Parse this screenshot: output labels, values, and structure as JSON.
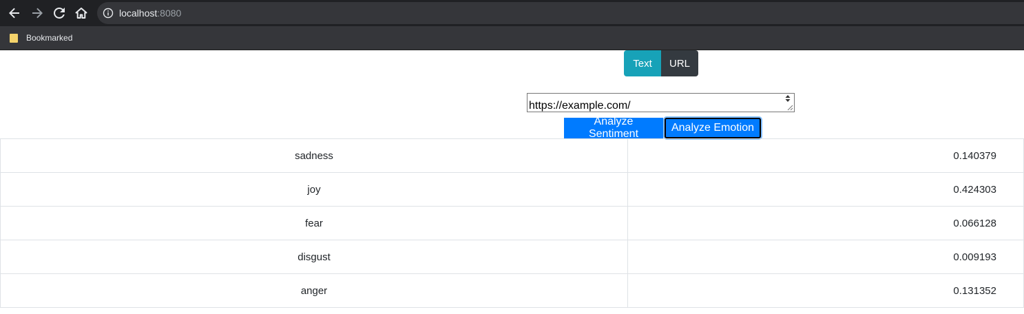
{
  "browser": {
    "url_host": "localhost",
    "url_port": ":8080",
    "bookmark_label": "Bookmarked"
  },
  "modes": {
    "text_label": "Text",
    "url_label": "URL",
    "text_color": "#17a2b8",
    "url_color": "#343a40"
  },
  "input": {
    "value": "https://example.com/"
  },
  "actions": {
    "sentiment_label": "Analyze Sentiment",
    "emotion_label": "Analyze Emotion",
    "color": "#007bff"
  },
  "results": [
    {
      "emotion": "sadness",
      "score": "0.140379"
    },
    {
      "emotion": "joy",
      "score": "0.424303"
    },
    {
      "emotion": "fear",
      "score": "0.066128"
    },
    {
      "emotion": "disgust",
      "score": "0.009193"
    },
    {
      "emotion": "anger",
      "score": "0.131352"
    }
  ]
}
